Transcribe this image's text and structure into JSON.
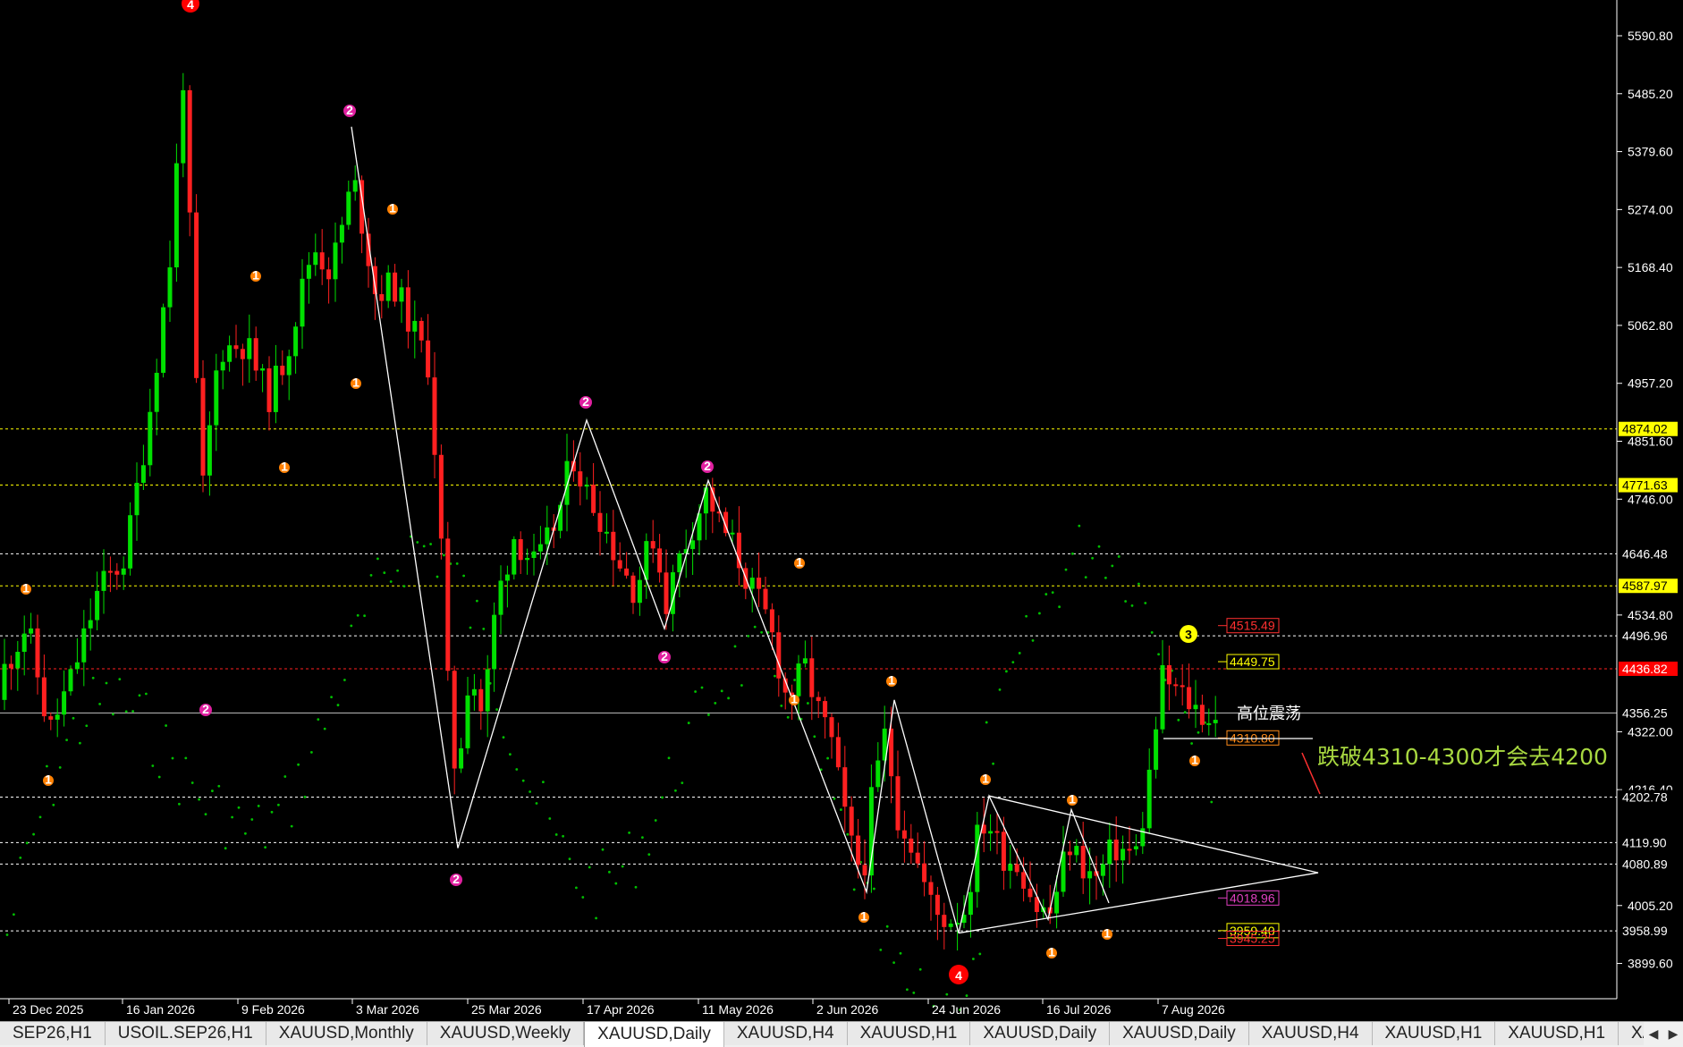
{
  "chart_data": {
    "type": "candlestick",
    "symbol": "XAUUSD",
    "timeframe": "Daily",
    "ylim": [
      3860,
      5630
    ],
    "price_axis_ticks": [
      "5590.80",
      "5485.20",
      "5379.60",
      "5274.00",
      "5168.40",
      "5062.80",
      "4957.20",
      "4851.60",
      "4746.00",
      "4534.80",
      "4322.00",
      "4216.40",
      "4005.20",
      "3899.60"
    ],
    "time_axis_labels": [
      "23 Dec 2025",
      "16 Jan 2026",
      "9 Feb 2026",
      "3 Mar 2026",
      "25 Mar 2026",
      "17 Apr 2026",
      "11 May 2026",
      "2 Jun 2026",
      "24 Jun 2026",
      "16 Jul 2026",
      "7 Aug 2026"
    ],
    "horizontal_levels": [
      {
        "price": "4874.02",
        "color": "#ffff00",
        "style": "dotted",
        "label_bg": "#ffff00",
        "label_fg": "#000000"
      },
      {
        "price": "4771.63",
        "color": "#ffff00",
        "style": "dotted",
        "label_bg": "#ffff00",
        "label_fg": "#000000"
      },
      {
        "price": "4646.48",
        "color": "#ffffff",
        "style": "dotted",
        "label_bg": "#000000",
        "label_fg": "#ffffff"
      },
      {
        "price": "4587.97",
        "color": "#ffff00",
        "style": "dotted",
        "label_bg": "#ffff00",
        "label_fg": "#000000"
      },
      {
        "price": "4496.96",
        "color": "#ffffff",
        "style": "dotted",
        "label_bg": "#000000",
        "label_fg": "#ffffff"
      },
      {
        "price": "4436.82",
        "color": "#ff2020",
        "style": "dotted",
        "label_bg": "#ff0000",
        "label_fg": "#ffffff"
      },
      {
        "price": "4356.25",
        "color": "#c0c0c0",
        "style": "solid",
        "label_bg": "#000000",
        "label_fg": "#ffffff"
      },
      {
        "price": "4202.78",
        "color": "#ffffff",
        "style": "dotted",
        "label_bg": "#000000",
        "label_fg": "#ffffff"
      },
      {
        "price": "4119.90",
        "color": "#ffffff",
        "style": "dotted",
        "label_bg": "#000000",
        "label_fg": "#ffffff"
      },
      {
        "price": "4080.89",
        "color": "#ffffff",
        "style": "dotted",
        "label_bg": "#000000",
        "label_fg": "#ffffff"
      },
      {
        "price": "3958.99",
        "color": "#ffffff",
        "style": "dotted",
        "label_bg": "#000000",
        "label_fg": "#ffffff"
      }
    ],
    "price_boxes": [
      {
        "price": "4515.49",
        "color": "#ff3030"
      },
      {
        "price": "4449.75",
        "color": "#ffff00"
      },
      {
        "price": "4310.80",
        "color": "#ff8c1a"
      },
      {
        "price": "4018.96",
        "color": "#e040c0"
      },
      {
        "price": "3959.40",
        "color": "#ffff00"
      },
      {
        "price": "3945.25",
        "color": "#ff3030"
      }
    ],
    "series": [
      {
        "name": "candles",
        "bull_color": "#00e000",
        "bear_color": "#ff2020"
      },
      {
        "name": "parabolic-sar",
        "color": "#00c000"
      }
    ],
    "wave_labels": [
      {
        "text": "4",
        "color": "#ff0000"
      },
      {
        "text": "4",
        "color": "#ff0000"
      },
      {
        "text": "3",
        "color": "#ffff00"
      },
      {
        "text": "2",
        "color": "#e020a0"
      },
      {
        "text": "1",
        "color": "#ff8000"
      }
    ],
    "annotations": [
      "高位震荡",
      "跌破4310-4300才会去4200"
    ]
  },
  "colors": {
    "background": "#000000",
    "bull": "#00e000",
    "bear": "#ff2020",
    "sar": "#00c000",
    "annotation_green": "#a8d840",
    "line_white": "#ffffff"
  },
  "tabs": [
    "SEP26,H1",
    "USOIL.SEP26,H1",
    "XAUUSD,Monthly",
    "XAUUSD,Weekly",
    "XAUUSD,Daily",
    "XAUUSD,H4",
    "XAUUSD,H1",
    "XAUUSD,Daily",
    "XAUUSD,Daily",
    "XAUUSD,H4",
    "XAUUSD,H1",
    "XAUUSD,H1",
    "XAU"
  ],
  "active_tab_index": 4,
  "tab_nav": [
    "◀",
    "▶"
  ]
}
